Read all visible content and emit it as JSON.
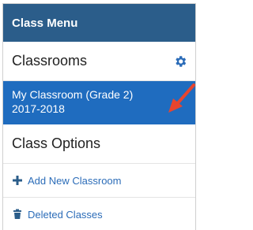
{
  "menu": {
    "title": "Class Menu"
  },
  "classrooms": {
    "heading": "Classrooms",
    "settings_icon": "gear-icon",
    "items": [
      {
        "line1": "My Classroom (Grade 2)",
        "line2": "2017-2018"
      }
    ]
  },
  "class_options": {
    "heading": "Class Options",
    "links": [
      {
        "label": "Add New Classroom",
        "icon": "plus-icon"
      },
      {
        "label": "Deleted Classes",
        "icon": "trash-icon"
      }
    ]
  },
  "colors": {
    "header_bg": "#2b5d8a",
    "selected_bg": "#1f6cbf",
    "link": "#2b6cb8",
    "arrow": "#e8452e"
  }
}
